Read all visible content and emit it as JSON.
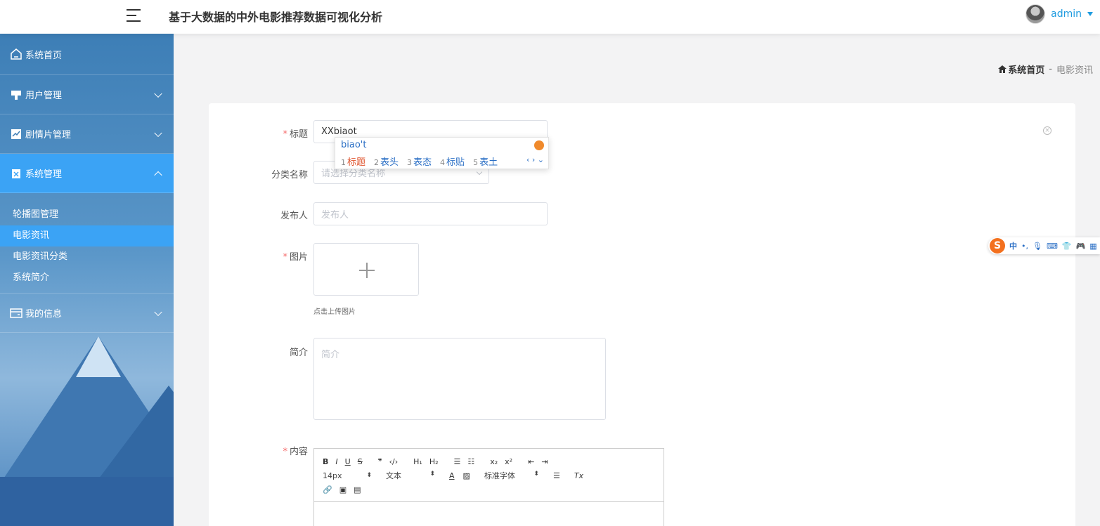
{
  "header": {
    "title": "基于大数据的中外电影推荐数据可视化分析",
    "user": "admin"
  },
  "sidebar": {
    "items": [
      {
        "label": "系统首页",
        "icon": "home-icon"
      },
      {
        "label": "用户管理",
        "icon": "user-manage-icon"
      },
      {
        "label": "剧情片管理",
        "icon": "chart-icon"
      },
      {
        "label": "系统管理",
        "icon": "system-icon"
      },
      {
        "label": "我的信息",
        "icon": "card-icon"
      }
    ],
    "sub_items": [
      "轮播图管理",
      "电影资讯",
      "电影资讯分类",
      "系统简介"
    ]
  },
  "breadcrumb": {
    "home": "系统首页",
    "sep": "-",
    "current": "电影资讯"
  },
  "form": {
    "title_label": "标题",
    "title_value": "XXbiaot",
    "category_label": "分类名称",
    "category_placeholder": "请选择分类名称",
    "publisher_label": "发布人",
    "publisher_placeholder": "发布人",
    "image_label": "图片",
    "upload_tip": "点击上传图片",
    "intro_label": "简介",
    "intro_placeholder": "简介",
    "content_label": "内容",
    "required_mark": "*"
  },
  "editor": {
    "row1": [
      "B",
      "I",
      "U",
      "S",
      "❞",
      "‹/›",
      "H₁",
      "H₂",
      "☰",
      "☷",
      "x₂",
      "x²",
      "⇤",
      "⇥"
    ],
    "size": "14px",
    "format": "文本",
    "font": "标准字体",
    "row3": [
      "🔗",
      "▣",
      "▤"
    ]
  },
  "ime": {
    "composition": "biao't",
    "candidates": [
      {
        "n": "1",
        "t": "标题"
      },
      {
        "n": "2",
        "t": "表头"
      },
      {
        "n": "3",
        "t": "表态"
      },
      {
        "n": "4",
        "t": "标贴"
      },
      {
        "n": "5",
        "t": "表土"
      }
    ]
  },
  "sogou": {
    "lang": "中",
    "punct": "•,"
  }
}
